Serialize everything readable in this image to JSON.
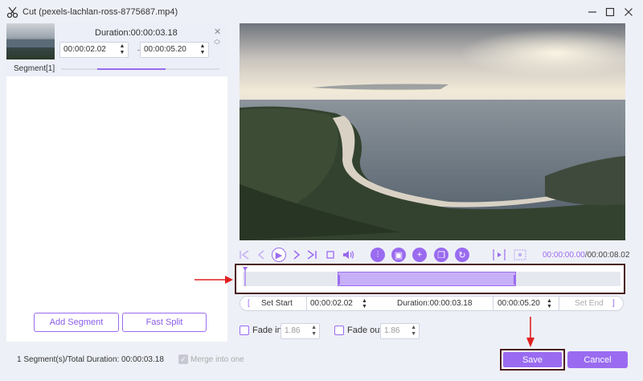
{
  "window": {
    "title": "Cut (pexels-lachlan-ross-8775687.mp4)",
    "minimize_icon": "minimize-icon",
    "maximize_icon": "maximize-icon",
    "close_icon": "close-icon"
  },
  "segment": {
    "duration_label": "Duration:00:00:03.18",
    "start_time": "00:00:02.02",
    "end_time": "00:00:05.20",
    "label": "Segment[1]",
    "progress_fraction": 0.43
  },
  "left_buttons": {
    "add_segment": "Add Segment",
    "fast_split": "Fast Split"
  },
  "controls": {
    "current_time": "00:00:00.00",
    "total_time": "/00:00:08.02"
  },
  "set_row": {
    "set_start": "Set Start",
    "start_time": "00:00:02.02",
    "duration": "Duration:00:00:03.18",
    "end_time": "00:00:05.20",
    "set_end": "Set End"
  },
  "fade": {
    "fade_in_label": "Fade in",
    "fade_in_value": "1.86",
    "fade_out_label": "Fade out",
    "fade_out_value": "1.86"
  },
  "bottom": {
    "summary": "1 Segment(s)/Total Duration: 00:00:03.18",
    "merge_label": "Merge into one",
    "save": "Save",
    "cancel": "Cancel"
  },
  "colors": {
    "accent": "#9a6bf0",
    "highlight_border": "#4a1d1d",
    "arrow": "#e02020"
  }
}
